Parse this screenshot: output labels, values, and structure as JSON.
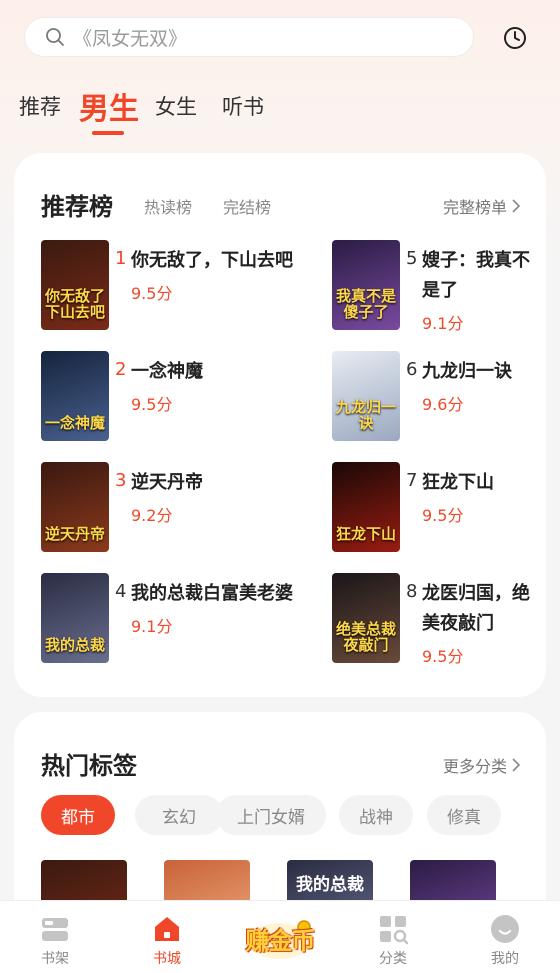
{
  "search": {
    "placeholder": "《凤女无双》"
  },
  "channels": [
    {
      "label": "推荐",
      "active": false
    },
    {
      "label": "男生",
      "active": true
    },
    {
      "label": "女生",
      "active": false
    },
    {
      "label": "听书",
      "active": false
    }
  ],
  "ranking": {
    "title": "推荐榜",
    "tabs": [
      "热读榜",
      "完结榜"
    ],
    "more": "完整榜单",
    "books": [
      {
        "rank": "1",
        "title": "你无敌了，下山去吧",
        "score": "9.5分",
        "cover_text": "你无敌了 下山去吧",
        "cover_colors": [
          "#3a1a10",
          "#7a2a18"
        ]
      },
      {
        "rank": "2",
        "title": "一念神魔",
        "score": "9.5分",
        "cover_text": "一念神魔",
        "cover_colors": [
          "#15233d",
          "#4a6290"
        ]
      },
      {
        "rank": "3",
        "title": "逆天丹帝",
        "score": "9.2分",
        "cover_text": "逆天丹帝",
        "cover_colors": [
          "#3a1810",
          "#8c3a1c"
        ]
      },
      {
        "rank": "4",
        "title": "我的总裁白富美老婆",
        "score": "9.1分",
        "cover_text": "我的总裁",
        "cover_colors": [
          "#2a2c42",
          "#6a6f8f"
        ]
      },
      {
        "rank": "5",
        "title": "嫂子：我真不是了",
        "score": "9.1分",
        "cover_text": "我真不是 傻子了",
        "cover_colors": [
          "#2a1c44",
          "#7a4aa0"
        ]
      },
      {
        "rank": "6",
        "title": "九龙归一诀",
        "score": "9.6分",
        "cover_text": "九龙归一诀",
        "cover_colors": [
          "#e8ecf2",
          "#9aa8c0"
        ]
      },
      {
        "rank": "7",
        "title": "狂龙下山",
        "score": "9.5分",
        "cover_text": "狂龙下山",
        "cover_colors": [
          "#1a0806",
          "#9a1c12"
        ]
      },
      {
        "rank": "8",
        "title": "龙医归国，绝美夜敲门",
        "score": "9.5分",
        "cover_text": "绝美总裁 夜敲门",
        "cover_colors": [
          "#1a1618",
          "#6a4a3a"
        ]
      }
    ]
  },
  "hot_tags": {
    "title": "热门标签",
    "more": "更多分类",
    "tags": [
      {
        "label": "都市",
        "active": true
      },
      {
        "label": "玄幻",
        "active": false
      },
      {
        "label": "上门女婿",
        "active": false
      },
      {
        "label": "战神",
        "active": false
      },
      {
        "label": "修真",
        "active": false
      }
    ],
    "covers": [
      {
        "text": "",
        "colors": [
          "#3a1a10",
          "#7a2a18"
        ]
      },
      {
        "text": "",
        "colors": [
          "#c8623a",
          "#f3b080"
        ]
      },
      {
        "text": "我的总裁",
        "colors": [
          "#2a2c42",
          "#6a6f8f"
        ]
      },
      {
        "text": "",
        "colors": [
          "#2a1c44",
          "#7a4aa0"
        ]
      }
    ]
  },
  "bottom_nav": [
    {
      "label": "书架",
      "active": false,
      "icon": "bookshelf-icon"
    },
    {
      "label": "书城",
      "active": true,
      "icon": "bookstore-icon"
    },
    {
      "label": "赚金币",
      "active": false,
      "icon": "earn-coins-icon"
    },
    {
      "label": "分类",
      "active": false,
      "icon": "category-icon"
    },
    {
      "label": "我的",
      "active": false,
      "icon": "profile-icon"
    }
  ],
  "colors": {
    "accent": "#f0462a",
    "score": "#ee4b2b"
  }
}
